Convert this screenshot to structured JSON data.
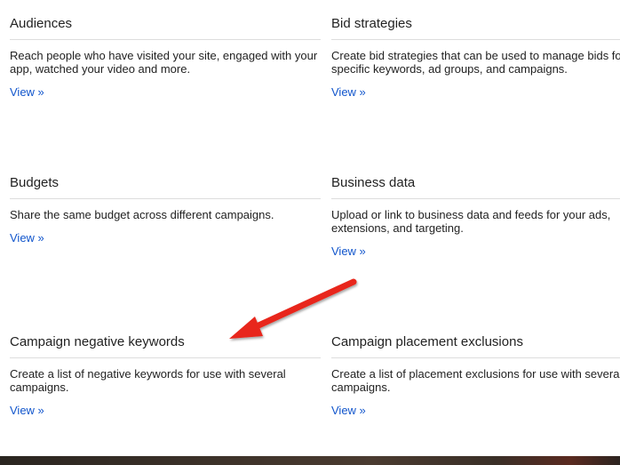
{
  "cards": [
    {
      "title": "Audiences",
      "description": "Reach people who have visited your site, engaged with your app, watched your video and more.",
      "link": "View »"
    },
    {
      "title": "Bid strategies",
      "description": "Create bid strategies that can be used to manage bids for specific keywords, ad groups, and campaigns.",
      "link": "View »"
    },
    {
      "title": "Budgets",
      "description": "Share the same budget across different campaigns.",
      "link": "View »"
    },
    {
      "title": "Business data",
      "description": "Upload or link to business data and feeds for your ads, extensions, and targeting.",
      "link": "View »"
    },
    {
      "title": "Campaign negative keywords",
      "description": "Create a list of negative keywords for use with several campaigns.",
      "link": "View »"
    },
    {
      "title": "Campaign placement exclusions",
      "description": "Create a list of placement exclusions for use with several campaigns.",
      "link": "View »"
    }
  ],
  "colors": {
    "link": "#1155cc",
    "divider": "#dddddd",
    "annotation_arrow": "#e8261a"
  },
  "annotation": {
    "icon": "red-arrow-icon"
  }
}
